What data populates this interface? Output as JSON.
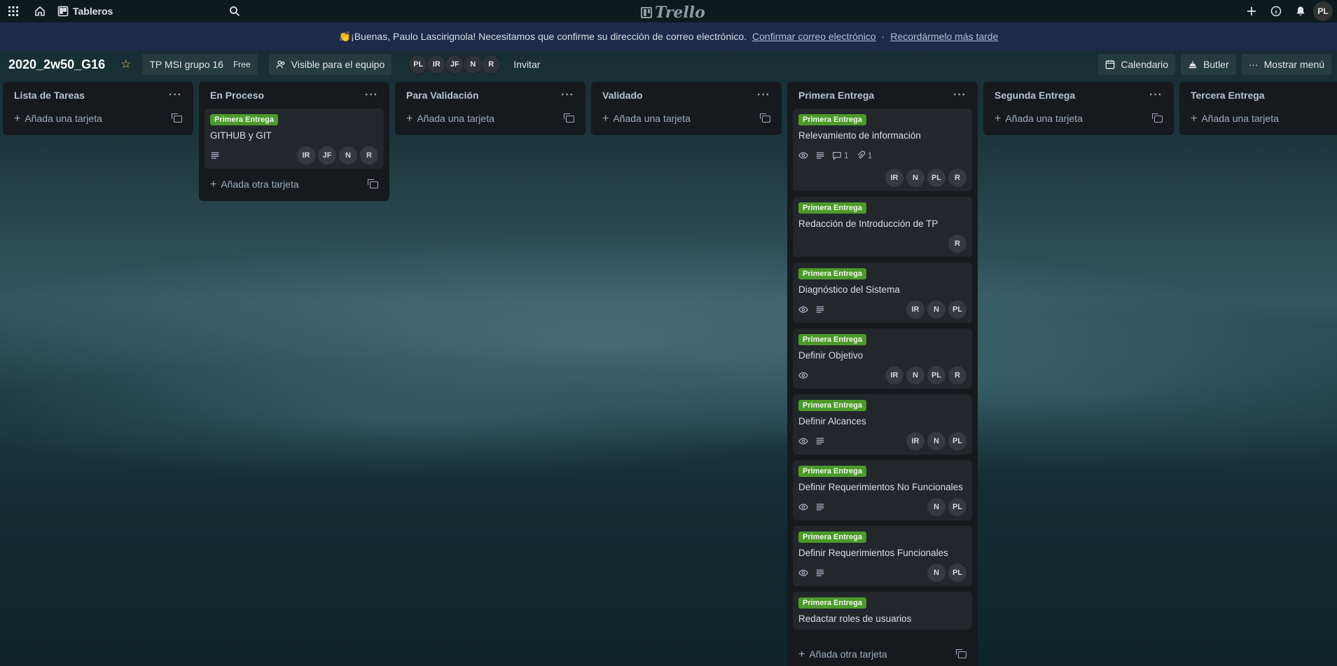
{
  "topbar": {
    "boards_label": "Tableros",
    "logo": "Trello",
    "user_initials": "PL"
  },
  "banner": {
    "message": "👏¡Buenas, Paulo Lascirignola! Necesitamos que confirme su dirección de correo electrónico.",
    "confirm": "Confirmar correo electrónico",
    "separator": "·",
    "later": "Recordármelo más tarde"
  },
  "board": {
    "title": "2020_2w50_G16",
    "team": "TP MSI grupo 16",
    "plan": "Free",
    "visibility": "Visible para el equipo",
    "members": [
      "PL",
      "IR",
      "JF",
      "N",
      "R"
    ],
    "invite": "Invitar",
    "calendar": "Calendario",
    "butler": "Butler",
    "menu": "Mostrar menú"
  },
  "lists": [
    {
      "title": "Lista de Tareas",
      "add": "Añada una tarjeta",
      "cards": []
    },
    {
      "title": "En Proceso",
      "add": "Añada otra tarjeta",
      "cards": [
        {
          "label": "Primera Entrega",
          "title": "GITHUB y GIT",
          "members": [
            "IR",
            "JF",
            "N",
            "R"
          ],
          "watch": false,
          "desc": true
        }
      ]
    },
    {
      "title": "Para Validación",
      "add": "Añada una tarjeta",
      "cards": []
    },
    {
      "title": "Validado",
      "add": "Añada una tarjeta",
      "cards": []
    },
    {
      "title": "Primera Entrega",
      "add": "Añada otra tarjeta",
      "cards": [
        {
          "label": "Primera Entrega",
          "title": "Relevamiento de información",
          "comments": "1",
          "attachments": "1",
          "members": [
            "IR",
            "N",
            "PL",
            "R"
          ]
        },
        {
          "label": "Primera Entrega",
          "title": "Redacción de Introducción de TP",
          "members": [
            "R"
          ]
        },
        {
          "label": "Primera Entrega",
          "title": "Diagnóstico del Sistema",
          "members": [
            "IR",
            "N",
            "PL"
          ]
        },
        {
          "label": "Primera Entrega",
          "title": "Definir Objetivo",
          "members": [
            "IR",
            "N",
            "PL",
            "R"
          ]
        },
        {
          "label": "Primera Entrega",
          "title": "Definir Alcances",
          "members": [
            "IR",
            "N",
            "PL"
          ]
        },
        {
          "label": "Primera Entrega",
          "title": "Definir Requerimientos No Funcionales",
          "members": [
            "N",
            "PL"
          ]
        },
        {
          "label": "Primera Entrega",
          "title": "Definir Requerimientos Funcionales",
          "members": [
            "N",
            "PL"
          ]
        },
        {
          "label": "Primera Entrega",
          "title": "Redactar roles de usuarios",
          "members": []
        }
      ]
    },
    {
      "title": "Segunda Entrega",
      "add": "Añada una tarjeta",
      "cards": []
    },
    {
      "title": "Tercera Entrega",
      "add": "Añada una tarjeta",
      "cards": []
    }
  ]
}
